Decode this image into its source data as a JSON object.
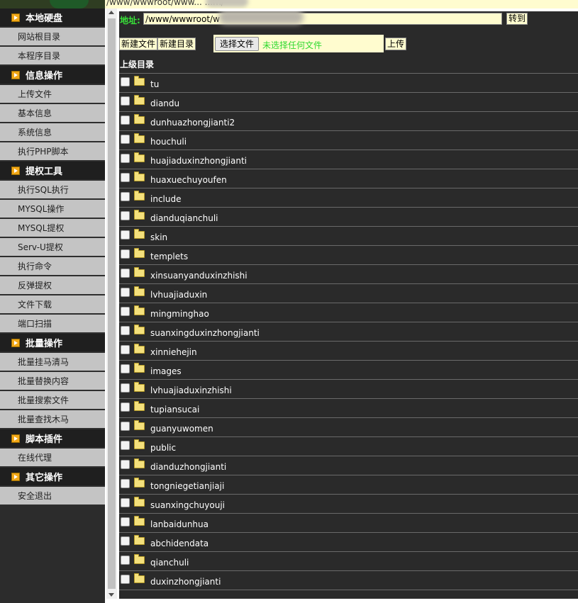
{
  "top_strip": {
    "path_text": "/www/wwwroot/www...   ...m/"
  },
  "sidebar": {
    "groups": [
      {
        "title": "本地硬盘",
        "items": [
          "网站根目录",
          "本程序目录"
        ]
      },
      {
        "title": "信息操作",
        "items": [
          "上传文件",
          "基本信息",
          "系统信息",
          "执行PHP脚本"
        ]
      },
      {
        "title": "提权工具",
        "items": [
          "执行SQL执行",
          "MYSQL操作",
          "MYSQL提权",
          "Serv-U提权",
          "执行命令",
          "反弹提权",
          "文件下载",
          "端口扫描"
        ]
      },
      {
        "title": "批量操作",
        "items": [
          "批量挂马清马",
          "批量替换内容",
          "批量搜索文件",
          "批量查找木马"
        ]
      },
      {
        "title": "脚本插件",
        "items": [
          "在线代理"
        ]
      },
      {
        "title": "其它操作",
        "items": [
          "安全退出"
        ]
      }
    ]
  },
  "address": {
    "label": "地址:",
    "value": "/www/wwwroot/w",
    "go_label": "转到"
  },
  "toolbar": {
    "new_file": "新建文件",
    "new_dir": "新建目录",
    "choose_file": "选择文件",
    "no_file": "未选择任何文件",
    "upload": "上传"
  },
  "list": {
    "parent": "上级目录",
    "folders": [
      "tu",
      "diandu",
      "dunhuazhongjianti2",
      "houchuli",
      "huajiaduxinzhongjianti",
      "huaxuechuyoufen",
      "include",
      "dianduqianchuli",
      "skin",
      "templets",
      "xinsuanyanduxinzhishi",
      "lvhuajiaduxin",
      "mingminghao",
      "suanxingduxinzhongjianti",
      "xinniehejin",
      "images",
      "lvhuajiaduxinzhishi",
      "tupiansucai",
      "guanyuwomen",
      "public",
      "dianduzhongjianti",
      "tongniegetianjiaji",
      "suanxingchuyouji",
      "lanbaidunhua",
      "abchidendata",
      "qianchuli",
      "duxinzhongjianti"
    ]
  },
  "colors": {
    "sidebar_item_bg": "#c4c4c4",
    "section_bg": "#1f1f1f",
    "accent_green": "#38e238",
    "input_bg": "#fffccf",
    "list_bg": "#2a2a2a"
  }
}
